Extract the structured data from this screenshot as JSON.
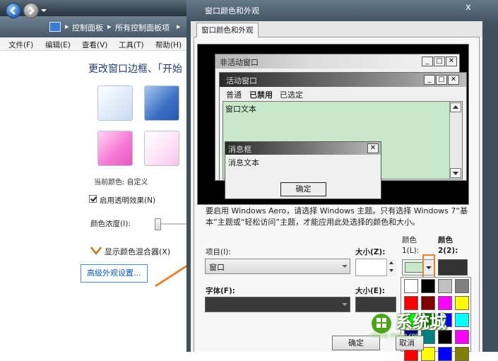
{
  "background_window": {
    "breadcrumb": [
      "控制面板",
      "所有控制面板项"
    ],
    "breadcrumb_sep": "▸",
    "menu": [
      "文件(F)",
      "编辑(E)",
      "查看(V)",
      "工具(T)",
      "帮助(H)"
    ],
    "heading": "更改窗口边框、「开始",
    "current_color": "当前颜色: 自定义",
    "transparency_label": "启用透明效果(N)",
    "transparency_checked": true,
    "intensity_label": "颜色浓度(I):",
    "mixer_label": "显示颜色混合器(X)",
    "advanced_link": "高级外观设置..."
  },
  "dialog": {
    "title": "窗口颜色和外观",
    "close": "x",
    "tab": "窗口颜色和外观",
    "preview": {
      "inactive_title": "非活动窗口",
      "active_title": "活动窗口",
      "menu": [
        "普通",
        "已禁用",
        "已选定"
      ],
      "window_text": "窗口文本",
      "msgbox_title": "消息框",
      "msgbox_text": "消息文本",
      "ok": "确定"
    },
    "info": "要启用 Windows Aero，请选择 Windows 主题。只有选择 Windows 7“基本”主题或“轻松访问”主题，才能应用此处选择的颜色和大小。",
    "item_label": "项目(I):",
    "item_value": "窗口",
    "size_label": "大小(Z):",
    "color1_label": "颜色 1(L):",
    "color2_label": "颜色 2(2):",
    "font_label": "字体(F):",
    "font_size_label": "大小(E):",
    "ok_button": "确定",
    "cancel_button": "取消"
  },
  "palette_colors": [
    "#ffffff",
    "#000000",
    "#c0c0c0",
    "#808080",
    "#ff0000",
    "#800000",
    "#ff00ff",
    "#ffff00",
    "#00ff00",
    "#008000",
    "#0000ff",
    "#00ffff",
    "#000080",
    "#008080",
    "#000000",
    "#ff00ff",
    "#ff0000",
    "#ffff00",
    "#0000ff",
    "#808000"
  ],
  "colors": {
    "window_text_bg": "#c7e8cb",
    "accent_highlight": "#e6812c",
    "link": "#0a58b8"
  },
  "watermark": {
    "text": "系统城",
    "sub": "xitong cheng.com"
  }
}
